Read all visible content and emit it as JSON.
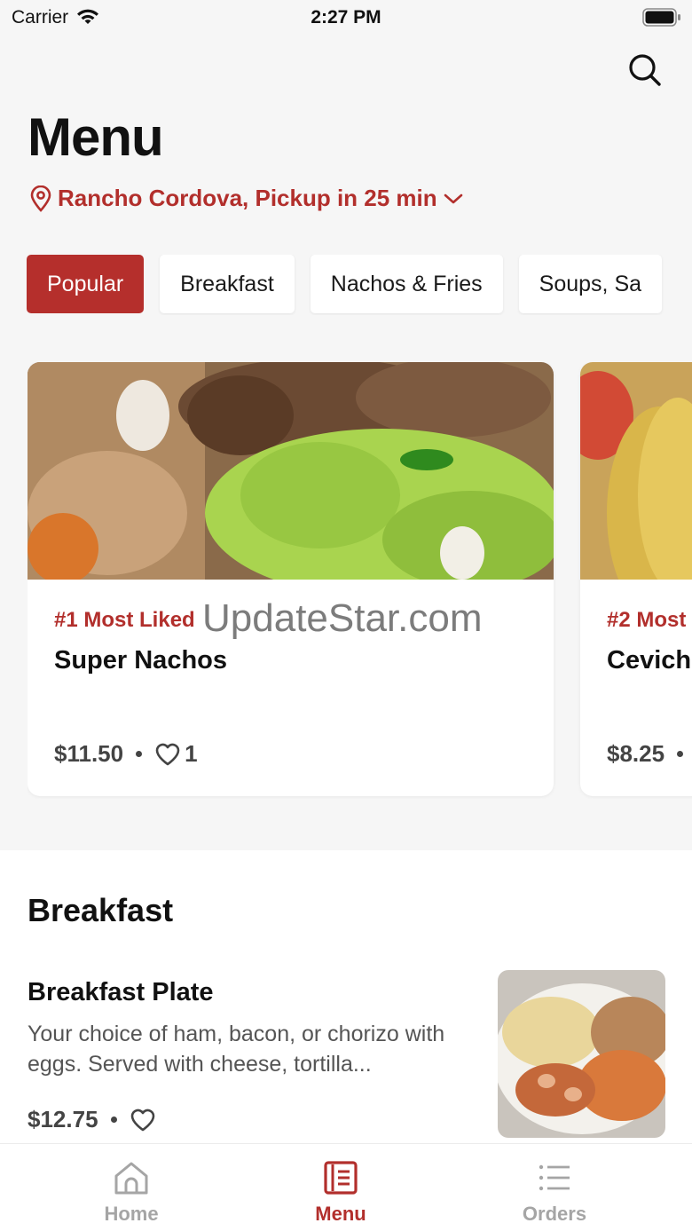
{
  "status_bar": {
    "carrier": "Carrier",
    "time": "2:27 PM"
  },
  "header": {
    "title": "Menu",
    "location": "Rancho Cordova, Pickup in 25 min"
  },
  "categories": [
    {
      "label": "Popular",
      "active": true
    },
    {
      "label": "Breakfast",
      "active": false
    },
    {
      "label": "Nachos & Fries",
      "active": false
    },
    {
      "label": "Soups, Sa",
      "active": false
    }
  ],
  "popular": [
    {
      "rank": "#1 Most Liked",
      "name": "Super Nachos",
      "price": "$11.50",
      "likes": "1"
    },
    {
      "rank": "#2 Most",
      "name": "Cevich",
      "price": "$8.25",
      "likes": ""
    }
  ],
  "watermark": "UpdateStar.com",
  "breakfast_section": {
    "title": "Breakfast",
    "items": [
      {
        "name": "Breakfast Plate",
        "description": "Your choice of ham, bacon, or chorizo with eggs. Served with cheese, tortilla...",
        "price": "$12.75"
      }
    ]
  },
  "tabbar": {
    "tabs": [
      {
        "label": "Home",
        "icon": "home-icon"
      },
      {
        "label": "Menu",
        "icon": "menu-book-icon",
        "active": true
      },
      {
        "label": "Orders",
        "icon": "list-icon"
      }
    ]
  },
  "colors": {
    "accent": "#b52f2c",
    "background": "#f6f6f6"
  }
}
